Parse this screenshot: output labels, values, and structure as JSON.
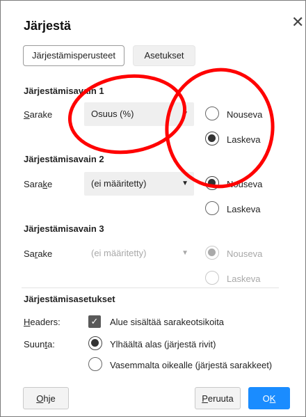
{
  "dialog": {
    "title": "Järjestä",
    "close_glyph": "✕"
  },
  "tabs": [
    {
      "label": "Järjestämisperusteet",
      "active": true
    },
    {
      "label": "Asetukset",
      "active": false
    }
  ],
  "sort_keys": [
    {
      "heading": "Järjestämisavain 1",
      "column_label": "Sarake",
      "selected": "Osuus (%)",
      "asc": "Nouseva",
      "desc": "Laskeva",
      "order": "desc",
      "enabled": true
    },
    {
      "heading": "Järjestämisavain 2",
      "column_label": "Sarake",
      "selected": "(ei määritetty)",
      "asc": "Nouseva",
      "desc": "Laskeva",
      "order": "asc",
      "enabled": true
    },
    {
      "heading": "Järjestämisavain 3",
      "column_label": "Sarake",
      "selected": "(ei määritetty)",
      "asc": "Nouseva",
      "desc": "Laskeva",
      "order": "asc",
      "enabled": false
    }
  ],
  "options": {
    "heading": "Järjestämisasetukset",
    "headers_label": "Headers:",
    "headers_checkbox_label": "Alue sisältää sarakeotsikoita",
    "headers_checked": true,
    "direction_label": "Suunta:",
    "direction_top": "Ylhäältä alas (järjestä rivit)",
    "direction_left": "Vasemmalta oikealle (järjestä sarakkeet)",
    "direction_selected": "top"
  },
  "buttons": {
    "help": "Ohje",
    "cancel": "Peruuta",
    "ok": "OK"
  },
  "annotation_color": "#ff0000",
  "accent_color": "#1a8cff"
}
